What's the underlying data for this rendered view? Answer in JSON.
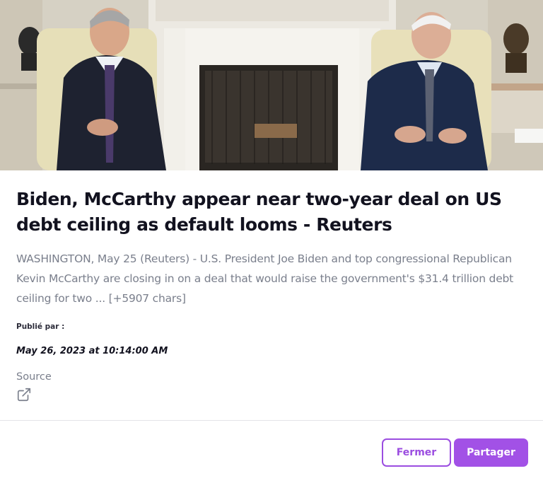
{
  "article": {
    "image_alt": "Kevin McCarthy and Joe Biden seated in front of a fireplace",
    "title": "Biden, McCarthy appear near two-year deal on US debt ceiling as default looms - Reuters",
    "description": "WASHINGTON, May 25 (Reuters) - U.S. President Joe Biden and top congressional Republican Kevin McCarthy are closing in on a deal that would raise the government's $31.4 trillion debt ceiling for two ... [+5907 chars]",
    "published_label": "Publié par :",
    "published_date": "May 26, 2023 at 10:14:00 AM",
    "source_label": "Source",
    "source_icon": "external-link-icon"
  },
  "actions": {
    "close_label": "Fermer",
    "share_label": "Partager"
  },
  "colors": {
    "accent": "#a251e6",
    "title": "#12121f",
    "muted": "#7a7f8c"
  }
}
